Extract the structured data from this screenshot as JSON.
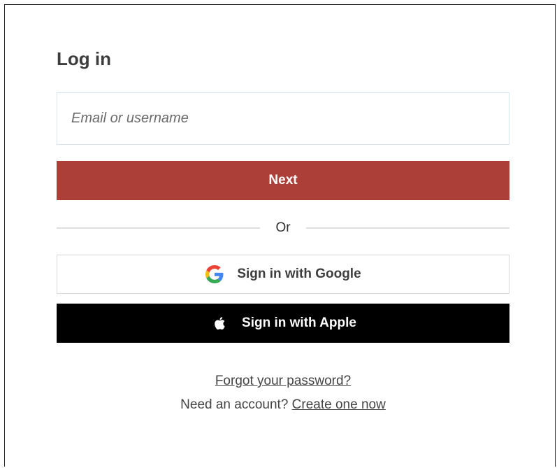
{
  "login": {
    "title": "Log in",
    "email_placeholder": "Email or username",
    "next_label": "Next",
    "divider_text": "Or",
    "google_label": "Sign in with Google",
    "apple_label": "Sign in with Apple",
    "forgot_label": "Forgot your password?",
    "need_account_text": "Need an account?",
    "create_label": "Create one now"
  },
  "colors": {
    "next_button": "#ac4039",
    "apple_button": "#000000"
  },
  "icons": {
    "google": "google-g-icon",
    "apple": "apple-icon"
  }
}
